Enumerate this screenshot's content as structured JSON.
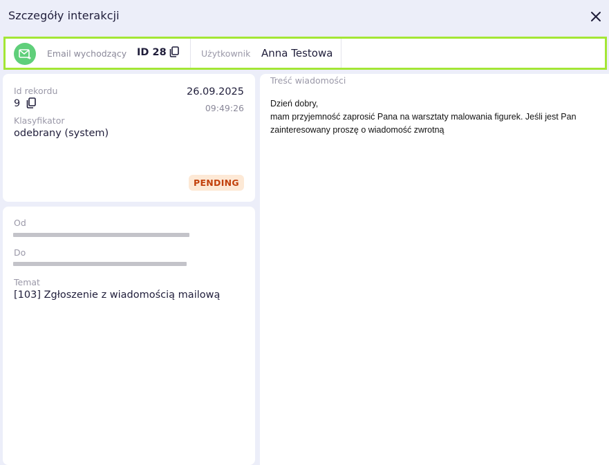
{
  "header": {
    "title": "Szczegóły interakcji"
  },
  "infobar": {
    "type_label": "Email wychodzący",
    "id_label": "ID 28",
    "user_label": "Użytkownik",
    "user_name": "Anna Testowa"
  },
  "record": {
    "id_label": "Id rekordu",
    "id_value": "9",
    "date": "26.09.2025",
    "time": "09:49:26",
    "classifier_label": "Klasyfikator",
    "classifier_value": "odebrany (system)",
    "status": "PENDING"
  },
  "mail": {
    "from_label": "Od",
    "to_label": "Do",
    "subject_label": "Temat",
    "subject_value": "[103] Zgłoszenie z wiadomością mailową"
  },
  "message": {
    "label": "Treść wiadomości",
    "lines": [
      "Dzień dobry,",
      "mam przyjemność zaprosić Pana na warsztaty malowania figurek. Jeśli jest Pan zainteresowany proszę o wiadomość zwrotną"
    ]
  },
  "colors": {
    "accent_border": "#a3e635",
    "mail_badge": "#5fcf7a",
    "status_bg": "#fde9d6",
    "status_text": "#c2410c"
  },
  "icons": {
    "close": "close-icon",
    "mail": "mail-outgoing-icon",
    "copy": "copy-icon"
  }
}
